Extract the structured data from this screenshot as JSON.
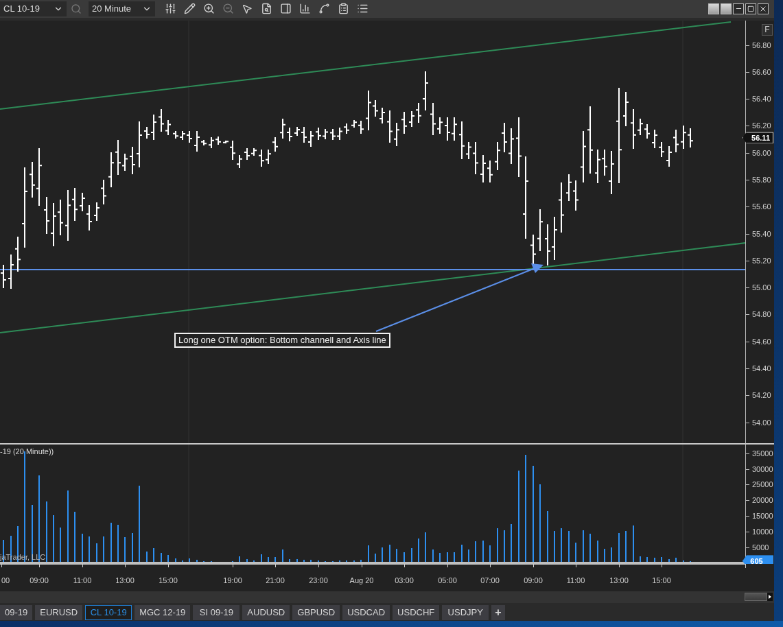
{
  "toolbar": {
    "instrument": "CL 10-19",
    "interval": "20 Minute"
  },
  "price_panel": {
    "annotation": "Long one OTM option: Bottom channell and Axis line",
    "axis_labels": [
      "56.80",
      "56.60",
      "56.40",
      "56.20",
      "56.00",
      "55.80",
      "55.60",
      "55.40",
      "55.20",
      "55.00",
      "54.80",
      "54.60",
      "54.40",
      "54.20",
      "54.00"
    ],
    "last_price": "56.11",
    "button": "F"
  },
  "volume_panel": {
    "title": "-19 (20 Minute))",
    "copyright": "jaTrader, LLC",
    "axis_labels": [
      "35000",
      "30000",
      "25000",
      "20000",
      "15000",
      "10000",
      "5000"
    ],
    "last_volume": "605"
  },
  "time_axis": [
    "00",
    "09:00",
    "11:00",
    "13:00",
    "15:00",
    "19:00",
    "21:00",
    "23:00",
    "Aug 20",
    "03:00",
    "05:00",
    "07:00",
    "09:00",
    "11:00",
    "13:00",
    "15:00"
  ],
  "tabs": [
    {
      "label": "09-19",
      "selected": false
    },
    {
      "label": "EURUSD",
      "selected": false
    },
    {
      "label": "CL 10-19",
      "selected": true
    },
    {
      "label": "MGC 12-19",
      "selected": false
    },
    {
      "label": "SI 09-19",
      "selected": false
    },
    {
      "label": "AUDUSD",
      "selected": false
    },
    {
      "label": "GBPUSD",
      "selected": false
    },
    {
      "label": "USDCAD",
      "selected": false
    },
    {
      "label": "USDCHF",
      "selected": false
    },
    {
      "label": "USDJPY",
      "selected": false
    }
  ],
  "add_tab": "+"
}
